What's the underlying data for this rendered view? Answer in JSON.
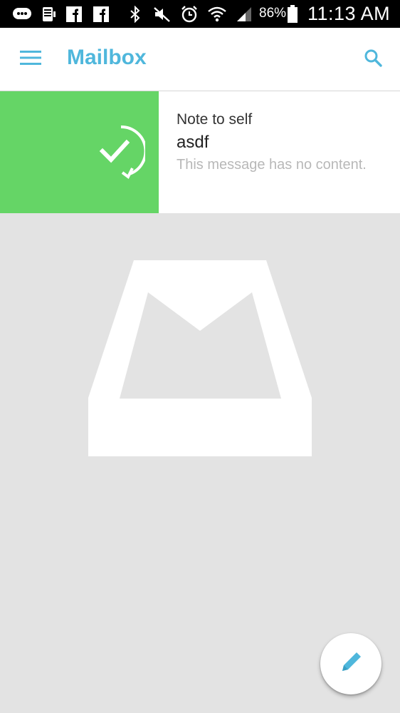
{
  "status_bar": {
    "battery_percent": "86%",
    "time": "11:13 AM",
    "icons": [
      "chat-bubble-icon",
      "voicemail-icon",
      "facebook-icon",
      "facebook-icon",
      "bluetooth-icon",
      "mute-icon",
      "alarm-icon",
      "wifi-icon",
      "signal-icon",
      "battery-icon"
    ]
  },
  "app_bar": {
    "title": "Mailbox",
    "menu_icon": "hamburger-menu-icon",
    "search_icon": "search-icon"
  },
  "message": {
    "sender": "Note to self",
    "subject": "asdf",
    "preview": "This message has no content.",
    "swipe_action_icon": "check-undo-icon"
  },
  "empty_state": {
    "icon": "mailbox-logo-icon"
  },
  "fab": {
    "icon": "compose-pencil-icon"
  },
  "colors": {
    "accent": "#4fb7dc",
    "swipe_green": "#65d566",
    "background": "#e3e3e3"
  }
}
